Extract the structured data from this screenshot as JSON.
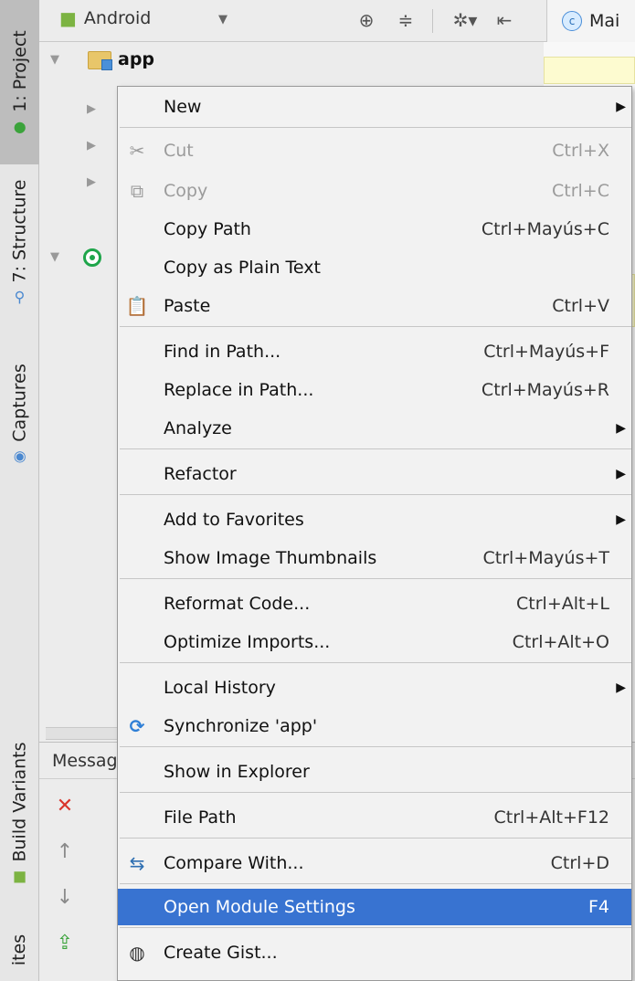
{
  "left_strip": {
    "tabs": [
      {
        "label": "1: Project",
        "mnemonic": "1"
      },
      {
        "label": "7: Structure",
        "mnemonic": "7"
      },
      {
        "label": "Captures"
      },
      {
        "label": "Build Variants"
      },
      {
        "label": "ites"
      }
    ]
  },
  "toolbar": {
    "view_selector": "Android",
    "editor_tab": "Mai",
    "editor_tab_badge": "c"
  },
  "tree": {
    "root": "app"
  },
  "messages": {
    "header": "Messag"
  },
  "context_menu": {
    "items": [
      {
        "label": "New",
        "shortcut": "",
        "submenu": true
      },
      {
        "label": "Cut",
        "shortcut": "Ctrl+X",
        "disabled": true,
        "icon": "scissors-icon"
      },
      {
        "label": "Copy",
        "shortcut": "Ctrl+C",
        "disabled": true,
        "icon": "copy-icon"
      },
      {
        "label": "Copy Path",
        "shortcut": "Ctrl+Mayús+C"
      },
      {
        "label": "Copy as Plain Text",
        "shortcut": ""
      },
      {
        "label": "Paste",
        "shortcut": "Ctrl+V",
        "icon": "paste-icon"
      },
      {
        "label": "Find in Path...",
        "shortcut": "Ctrl+Mayús+F"
      },
      {
        "label": "Replace in Path...",
        "shortcut": "Ctrl+Mayús+R"
      },
      {
        "label": "Analyze",
        "shortcut": "",
        "submenu": true
      },
      {
        "label": "Refactor",
        "shortcut": "",
        "submenu": true
      },
      {
        "label": "Add to Favorites",
        "shortcut": "",
        "submenu": true
      },
      {
        "label": "Show Image Thumbnails",
        "shortcut": "Ctrl+Mayús+T"
      },
      {
        "label": "Reformat Code...",
        "shortcut": "Ctrl+Alt+L"
      },
      {
        "label": "Optimize Imports...",
        "shortcut": "Ctrl+Alt+O"
      },
      {
        "label": "Local History",
        "shortcut": "",
        "submenu": true
      },
      {
        "label": "Synchronize 'app'",
        "shortcut": "",
        "icon": "sync-icon"
      },
      {
        "label": "Show in Explorer",
        "shortcut": ""
      },
      {
        "label": "File Path",
        "shortcut": "Ctrl+Alt+F12"
      },
      {
        "label": "Compare With...",
        "shortcut": "Ctrl+D",
        "icon": "compare-icon"
      },
      {
        "label": "Open Module Settings",
        "shortcut": "F4",
        "selected": true
      },
      {
        "label": "Create Gist...",
        "shortcut": "",
        "icon": "github-icon"
      }
    ]
  },
  "colors": {
    "selection": "#3873d1",
    "menu_bg": "#f2f2f2",
    "disabled_text": "#9b9b9b"
  }
}
